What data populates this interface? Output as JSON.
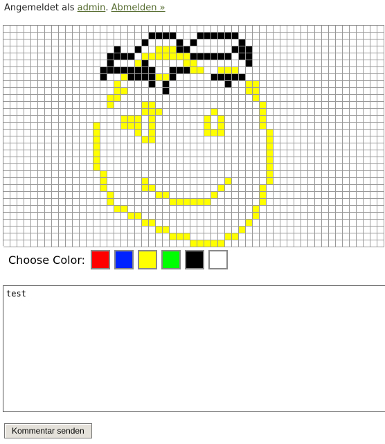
{
  "login": {
    "prefix": "Angemeldet als ",
    "user_link": "admin",
    "separator": ". ",
    "logout_link": "Abmelden »"
  },
  "palette": {
    "label": "Choose Color:",
    "colors": [
      {
        "name": "red",
        "hex": "#ff0000"
      },
      {
        "name": "blue",
        "hex": "#0022ff"
      },
      {
        "name": "yellow",
        "hex": "#ffff00"
      },
      {
        "name": "green",
        "hex": "#00ff00"
      },
      {
        "name": "black",
        "hex": "#000000"
      },
      {
        "name": "white",
        "hex": "#ffffff"
      }
    ]
  },
  "comment": {
    "value": "test"
  },
  "submit_label": "Kommentar senden",
  "canvas": {
    "columns": 55,
    "rows": 32,
    "black_cells": [
      [
        1,
        21
      ],
      [
        1,
        22
      ],
      [
        1,
        23
      ],
      [
        1,
        24
      ],
      [
        1,
        28
      ],
      [
        1,
        29
      ],
      [
        1,
        30
      ],
      [
        1,
        31
      ],
      [
        1,
        32
      ],
      [
        1,
        33
      ],
      [
        2,
        20
      ],
      [
        2,
        25
      ],
      [
        2,
        27
      ],
      [
        2,
        34
      ],
      [
        3,
        16
      ],
      [
        3,
        19
      ],
      [
        3,
        25
      ],
      [
        3,
        26
      ],
      [
        3,
        33
      ],
      [
        3,
        34
      ],
      [
        3,
        35
      ],
      [
        4,
        15
      ],
      [
        4,
        16
      ],
      [
        4,
        17
      ],
      [
        4,
        18
      ],
      [
        4,
        27
      ],
      [
        4,
        28
      ],
      [
        4,
        29
      ],
      [
        4,
        30
      ],
      [
        4,
        31
      ],
      [
        4,
        32
      ],
      [
        4,
        34
      ],
      [
        4,
        35
      ],
      [
        5,
        15
      ],
      [
        5,
        20
      ],
      [
        5,
        35
      ],
      [
        6,
        14
      ],
      [
        6,
        15
      ],
      [
        6,
        16
      ],
      [
        6,
        17
      ],
      [
        6,
        18
      ],
      [
        6,
        19
      ],
      [
        6,
        20
      ],
      [
        6,
        21
      ],
      [
        6,
        24
      ],
      [
        6,
        25
      ],
      [
        6,
        26
      ],
      [
        7,
        14
      ],
      [
        7,
        18
      ],
      [
        7,
        19
      ],
      [
        7,
        20
      ],
      [
        7,
        21
      ],
      [
        7,
        24
      ],
      [
        7,
        30
      ],
      [
        7,
        31
      ],
      [
        7,
        32
      ],
      [
        7,
        33
      ],
      [
        7,
        34
      ],
      [
        8,
        21
      ],
      [
        8,
        23
      ],
      [
        8,
        32
      ],
      [
        9,
        23
      ]
    ],
    "yellow_cells": [
      [
        3,
        22
      ],
      [
        3,
        23
      ],
      [
        3,
        24
      ],
      [
        4,
        20
      ],
      [
        4,
        21
      ],
      [
        4,
        22
      ],
      [
        4,
        23
      ],
      [
        4,
        24
      ],
      [
        4,
        25
      ],
      [
        4,
        26
      ],
      [
        5,
        19
      ],
      [
        5,
        20
      ],
      [
        5,
        26
      ],
      [
        5,
        27
      ],
      [
        6,
        27
      ],
      [
        6,
        28
      ],
      [
        6,
        31
      ],
      [
        6,
        32
      ],
      [
        6,
        33
      ],
      [
        7,
        17
      ],
      [
        7,
        22
      ],
      [
        7,
        23
      ],
      [
        7,
        33
      ],
      [
        7,
        34
      ],
      [
        8,
        16
      ],
      [
        8,
        35
      ],
      [
        8,
        36
      ],
      [
        9,
        16
      ],
      [
        9,
        17
      ],
      [
        9,
        35
      ],
      [
        9,
        36
      ],
      [
        10,
        15
      ],
      [
        10,
        16
      ],
      [
        10,
        36
      ],
      [
        11,
        15
      ],
      [
        11,
        20
      ],
      [
        11,
        21
      ],
      [
        11,
        37
      ],
      [
        12,
        20
      ],
      [
        12,
        21
      ],
      [
        12,
        22
      ],
      [
        12,
        30
      ],
      [
        12,
        37
      ],
      [
        13,
        17
      ],
      [
        13,
        18
      ],
      [
        13,
        19
      ],
      [
        13,
        21
      ],
      [
        13,
        29
      ],
      [
        13,
        31
      ],
      [
        13,
        37
      ],
      [
        14,
        13
      ],
      [
        14,
        17
      ],
      [
        14,
        18
      ],
      [
        14,
        19
      ],
      [
        14,
        21
      ],
      [
        14,
        29
      ],
      [
        14,
        31
      ],
      [
        14,
        37
      ],
      [
        15,
        13
      ],
      [
        15,
        19
      ],
      [
        15,
        21
      ],
      [
        15,
        29
      ],
      [
        15,
        30
      ],
      [
        15,
        31
      ],
      [
        15,
        38
      ],
      [
        16,
        13
      ],
      [
        16,
        20
      ],
      [
        16,
        21
      ],
      [
        16,
        38
      ],
      [
        17,
        13
      ],
      [
        17,
        38
      ],
      [
        18,
        13
      ],
      [
        18,
        38
      ],
      [
        19,
        13
      ],
      [
        19,
        38
      ],
      [
        20,
        13
      ],
      [
        20,
        38
      ],
      [
        21,
        14
      ],
      [
        21,
        38
      ],
      [
        22,
        14
      ],
      [
        22,
        20
      ],
      [
        22,
        32
      ],
      [
        22,
        38
      ],
      [
        23,
        14
      ],
      [
        23,
        20
      ],
      [
        23,
        21
      ],
      [
        23,
        31
      ],
      [
        23,
        37
      ],
      [
        24,
        15
      ],
      [
        24,
        22
      ],
      [
        24,
        23
      ],
      [
        24,
        30
      ],
      [
        24,
        37
      ],
      [
        25,
        15
      ],
      [
        25,
        24
      ],
      [
        25,
        25
      ],
      [
        25,
        26
      ],
      [
        25,
        27
      ],
      [
        25,
        28
      ],
      [
        25,
        29
      ],
      [
        25,
        37
      ],
      [
        26,
        16
      ],
      [
        26,
        17
      ],
      [
        26,
        36
      ],
      [
        27,
        18
      ],
      [
        27,
        19
      ],
      [
        27,
        36
      ],
      [
        28,
        20
      ],
      [
        28,
        21
      ],
      [
        28,
        35
      ],
      [
        29,
        22
      ],
      [
        29,
        23
      ],
      [
        29,
        34
      ],
      [
        30,
        24
      ],
      [
        30,
        25
      ],
      [
        30,
        26
      ],
      [
        30,
        32
      ],
      [
        30,
        33
      ],
      [
        31,
        27
      ],
      [
        31,
        28
      ],
      [
        31,
        29
      ],
      [
        31,
        30
      ],
      [
        31,
        31
      ]
    ]
  }
}
